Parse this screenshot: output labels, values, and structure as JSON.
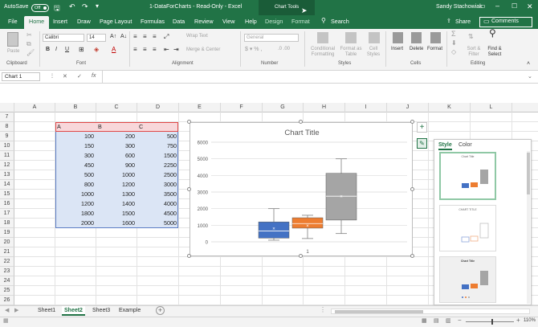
{
  "titlebar": {
    "autosave": "AutoSave",
    "autosave_state": "Off",
    "file_title": "1-DataForCharts - Read-Only - Excel",
    "chart_tools": "Chart Tools",
    "user": "Sandy Stachowiak"
  },
  "tabs": [
    "File",
    "Home",
    "Insert",
    "Draw",
    "Page Layout",
    "Formulas",
    "Data",
    "Review",
    "View",
    "Help",
    "Design",
    "Format"
  ],
  "search_placeholder": "Search",
  "share_label": "Share",
  "comments_label": "Comments",
  "ribbon": {
    "paste": "Paste",
    "clipboard": "Clipboard",
    "font_name": "Calibri",
    "font_size": "14",
    "font": "Font",
    "wrap_text": "Wrap Text",
    "merge_center": "Merge & Center",
    "alignment": "Alignment",
    "number_format": "General",
    "number": "Number",
    "conditional_formatting": "Conditional Formatting",
    "format_as_table": "Format as Table",
    "cell_styles": "Cell Styles",
    "styles": "Styles",
    "insert": "Insert",
    "delete": "Delete",
    "format": "Format",
    "cells": "Cells",
    "sort_filter": "Sort & Filter",
    "find_select": "Find & Select",
    "editing": "Editing",
    "bold": "B",
    "italic": "I",
    "underline": "U"
  },
  "namebox": "Chart 1",
  "formula_cancel": "✕",
  "formula_enter": "✓",
  "formula_fx": "fx",
  "columns": [
    "A",
    "B",
    "C",
    "D",
    "E",
    "F",
    "G",
    "H",
    "I",
    "J",
    "K",
    "L"
  ],
  "rows": [
    "7",
    "8",
    "9",
    "10",
    "11",
    "12",
    "13",
    "14",
    "15",
    "16",
    "17",
    "18",
    "19",
    "20",
    "21",
    "22",
    "23",
    "24",
    "25",
    "26"
  ],
  "table": {
    "headers": [
      "A",
      "B",
      "C"
    ],
    "data": [
      [
        "100",
        "200",
        "500"
      ],
      [
        "150",
        "300",
        "750"
      ],
      [
        "300",
        "600",
        "1500"
      ],
      [
        "450",
        "900",
        "2250"
      ],
      [
        "500",
        "1000",
        "2500"
      ],
      [
        "800",
        "1200",
        "3000"
      ],
      [
        "1000",
        "1300",
        "3500"
      ],
      [
        "1200",
        "1400",
        "4000"
      ],
      [
        "1800",
        "1500",
        "4500"
      ],
      [
        "2000",
        "1600",
        "5000"
      ]
    ]
  },
  "chart_data": {
    "type": "box",
    "title": "Chart Title",
    "categories": [
      "1"
    ],
    "ylim": [
      0,
      6000
    ],
    "yticks": [
      "0",
      "1000",
      "2000",
      "3000",
      "4000",
      "5000",
      "6000"
    ],
    "grid": true,
    "series": [
      {
        "color": "#4472c4",
        "min": 100,
        "q1": 225,
        "median": 650,
        "q3": 1200,
        "max": 2000,
        "mean": 830
      },
      {
        "color": "#ed7d31",
        "min": 200,
        "q1": 825,
        "median": 1100,
        "q3": 1450,
        "max": 1600,
        "mean": 1000
      },
      {
        "color": "#a5a5a5",
        "min": 500,
        "q1": 1312,
        "median": 2750,
        "q3": 4125,
        "max": 5000,
        "mean": 2750
      }
    ]
  },
  "style_pane": {
    "tabs": [
      "Style",
      "Color"
    ],
    "thumb_title_1": "Chart Title",
    "thumb_title_2": "CHART TITLE",
    "thumb_title_3": "Chart Title"
  },
  "sheets": [
    "Sheet1",
    "Sheet2",
    "Sheet3",
    "Example"
  ],
  "zoom": "110%",
  "colors": {
    "excel_green": "#217346",
    "table_header": "#f8d7da",
    "table_fill": "#dbe5f5"
  }
}
